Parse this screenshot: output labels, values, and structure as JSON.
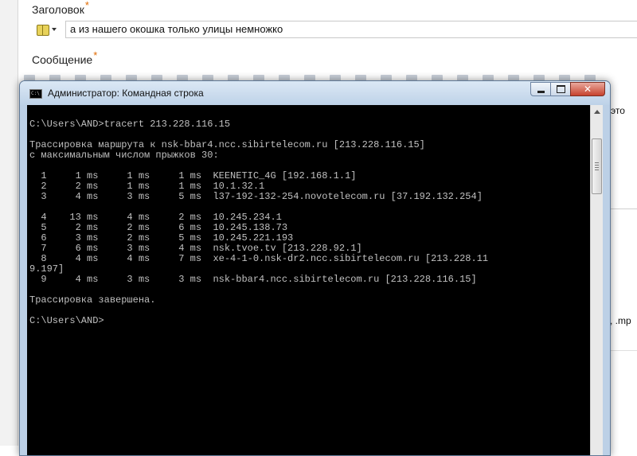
{
  "form": {
    "title_label": "Заголовок",
    "required_mark": "*",
    "title_value": "а из нашего окошка только улицы немножко",
    "message_label": "Сообщение",
    "side_text_1": "это",
    "side_text_2": ", .mp"
  },
  "window": {
    "title": "Администратор: Командная строка",
    "icon_label": "C:\\"
  },
  "console": {
    "lines": [
      "C:\\Users\\AND>tracert 213.228.116.15",
      "",
      "Трассировка маршрута к nsk-bbar4.ncc.sibirtelecom.ru [213.228.116.15]",
      "с максимальным числом прыжков 30:",
      "",
      "  1     1 ms     1 ms     1 ms  KEENETIC_4G [192.168.1.1]",
      "  2     2 ms     1 ms     1 ms  10.1.32.1",
      "  3     4 ms     3 ms     5 ms  l37-192-132-254.novotelecom.ru [37.192.132.254]",
      "",
      "  4    13 ms     4 ms     2 ms  10.245.234.1",
      "  5     2 ms     2 ms     6 ms  10.245.138.73",
      "  6     3 ms     2 ms     5 ms  10.245.221.193",
      "  7     6 ms     3 ms     4 ms  nsk.tvoe.tv [213.228.92.1]",
      "  8     4 ms     4 ms     7 ms  xe-4-1-0.nsk-dr2.ncc.sibirtelecom.ru [213.228.11",
      "9.197]",
      "  9     4 ms     3 ms     3 ms  nsk-bbar4.ncc.sibirtelecom.ru [213.228.116.15]",
      "",
      "Трассировка завершена.",
      "",
      "C:\\Users\\AND>"
    ]
  },
  "colors": {
    "console_bg": "#000000",
    "console_text": "#c0c0c0",
    "required_mark": "#e06a00",
    "titlebar": "#bed2e8",
    "close_button": "#c7422d"
  }
}
